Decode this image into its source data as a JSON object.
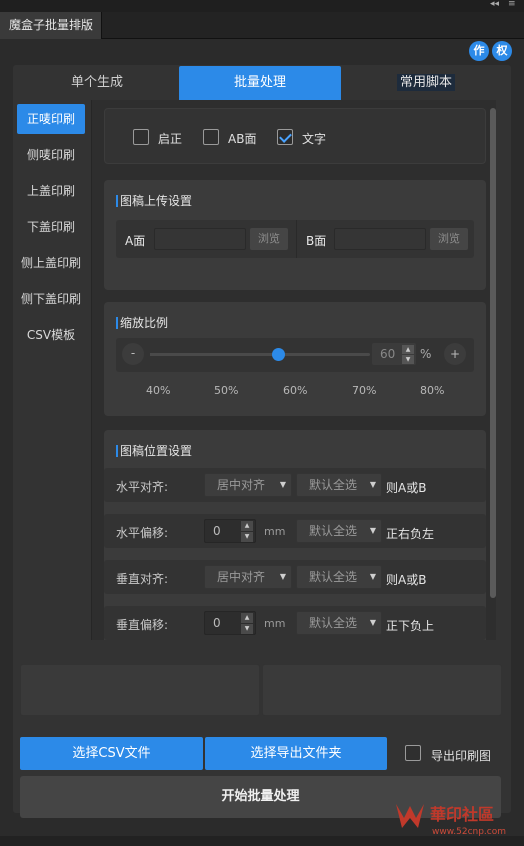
{
  "window": {
    "title": "魔盒子批量排版",
    "collapse_glyph": "◂◂",
    "menu_glyph": "≡"
  },
  "corner_buttons": [
    {
      "label": "作"
    },
    {
      "label": "权"
    }
  ],
  "top_tabs": [
    {
      "label": "单个生成",
      "active": false
    },
    {
      "label": "批量处理",
      "active": true
    },
    {
      "label": "常用脚本",
      "active": false
    }
  ],
  "sidebar": {
    "items": [
      {
        "label": "正唛印刷",
        "active": true
      },
      {
        "label": "侧唛印刷",
        "active": false
      },
      {
        "label": "上盖印刷",
        "active": false
      },
      {
        "label": "下盖印刷",
        "active": false
      },
      {
        "label": "侧上盖印刷",
        "active": false
      },
      {
        "label": "侧下盖印刷",
        "active": false
      },
      {
        "label": "CSV模板",
        "active": false
      }
    ]
  },
  "options": {
    "items": [
      {
        "label": "启正",
        "checked": false
      },
      {
        "label": "AB面",
        "checked": false
      },
      {
        "label": "文字",
        "checked": true
      }
    ]
  },
  "upload": {
    "title": "图稿上传设置",
    "a_label": "A面",
    "b_label": "B面",
    "browse_a": "浏览",
    "browse_b": "浏览"
  },
  "zoom": {
    "title": "缩放比例",
    "minus": "-",
    "plus": "+",
    "value": "60",
    "unit": "%",
    "level_percent": 60,
    "ticks": [
      "40%",
      "50%",
      "60%",
      "70%",
      "80%"
    ]
  },
  "position": {
    "title": "图稿位置设置",
    "rows": [
      {
        "label": "水平对齐:",
        "type": "select",
        "select1": "居中对齐",
        "select2": "默认全选",
        "note": "则A或B"
      },
      {
        "label": "水平偏移:",
        "type": "spin",
        "value": "0",
        "unit": "mm",
        "select2": "默认全选",
        "note": "正右负左"
      },
      {
        "label": "垂直对齐:",
        "type": "select",
        "select1": "居中对齐",
        "select2": "默认全选",
        "note": "则A或B"
      },
      {
        "label": "垂直偏移:",
        "type": "spin",
        "value": "0",
        "unit": "mm",
        "select2": "默认全选",
        "note": "正下负上"
      }
    ]
  },
  "actions": {
    "choose_csv": "选择CSV文件",
    "choose_folder": "选择导出文件夹",
    "export_print_label": "导出印刷图",
    "export_print_checked": false,
    "start": "开始批量处理"
  },
  "watermark": {
    "brand": "華印社區",
    "url": "www.52cnp.com"
  },
  "colors": {
    "accent": "#2c8ae8",
    "panel": "#333333",
    "background": "#2b2b2b"
  }
}
